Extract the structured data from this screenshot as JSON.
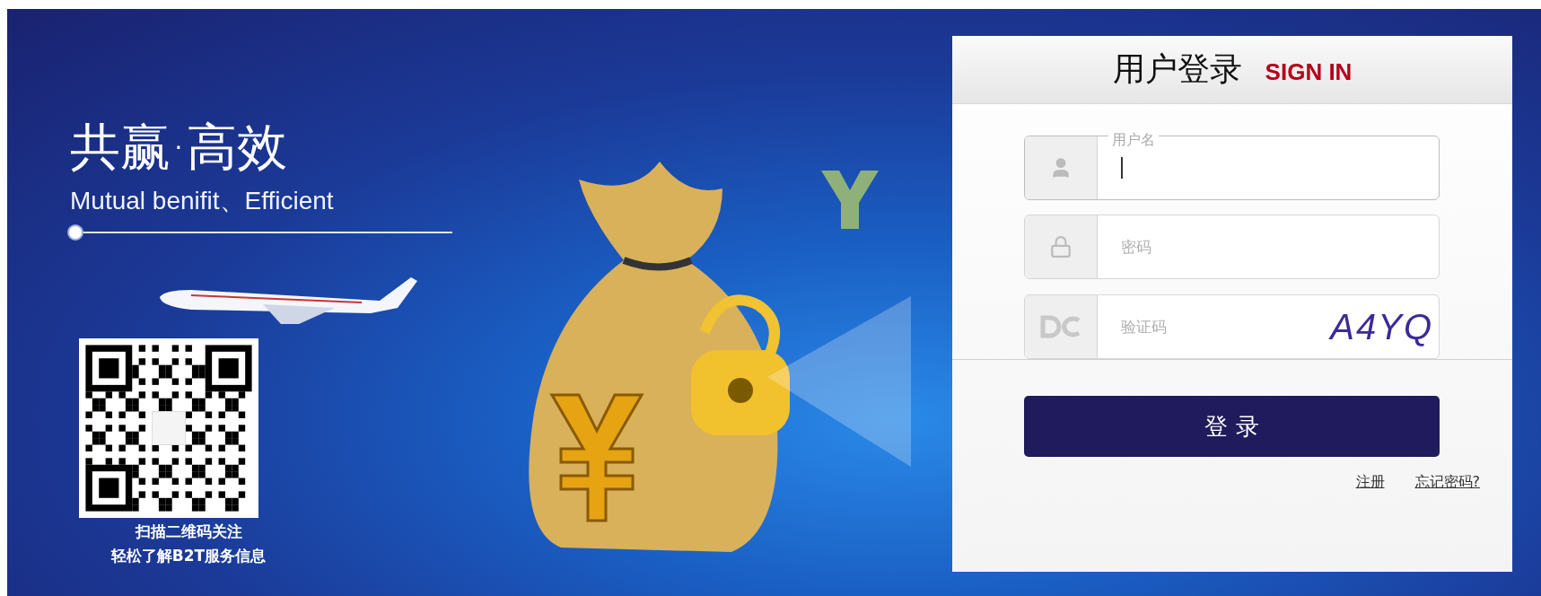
{
  "slogan": {
    "title": "共赢·高效",
    "subtitle": "Mutual benifit、Efficient"
  },
  "qr_caption": [
    "扫描二维码关注",
    "轻松了解B2T服务信息"
  ],
  "login": {
    "title": "用户登录",
    "title_en": "SIGN IN",
    "fields": [
      {
        "kind": "user",
        "label": "用户名",
        "focused": true
      },
      {
        "kind": "password",
        "placeholder": "密码",
        "focused": false
      },
      {
        "kind": "captcha",
        "placeholder": "验证码",
        "focused": false,
        "captcha": "A4YQ"
      }
    ],
    "submit": "登 录",
    "links": [
      "注册",
      "忘记密码?"
    ]
  }
}
